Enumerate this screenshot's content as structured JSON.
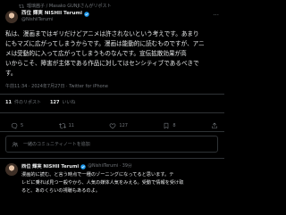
{
  "repost": {
    "text": "瑠璃茜子 / Masako GUNJIさんがリポスト"
  },
  "tweet": {
    "author_name": "西位 輝実 NISHII Terumi",
    "author_handle": "@NishiiTerumi",
    "body": "私は、漫画まではギリだけどアニメは許されないという考えです。あまり\nにもマズに広がってしまうからです。漫画は能動的に読むものですが、アニ\nメは受動的に入って広がってしまうものなんです。宣伝拡散効果が高\nいからこそ、障害が主体である作品に対してはセンシティブであるべきで\nす。",
    "timestamp": "午前11:34 · 2024年7月27日",
    "source": "Twitter for iPhone"
  },
  "stats": {
    "reposts_count": "11",
    "reposts_label": "件のリポスト",
    "likes_count": "127",
    "likes_label": "いいね"
  },
  "actions": {
    "reply_count": "5",
    "retweet_count": "11",
    "like_count": "127",
    "bookmark_count": "8"
  },
  "note_prompt": {
    "text": "一緒のコミュニティノートを追加"
  },
  "reply": {
    "author_name": "西位 輝実 NISHII Terumi",
    "author_handle": "@NishiiTerumi · 39分",
    "body": "漫画的に読む、と言う時点で一種のゾーニングになってると思います。テ\nレビに乗れば見つー般やから、人気の媒体人気をみえる。受動で情報を受け取\nると、あのくらいの視聴もあるのよ。"
  },
  "colors": {
    "background": "#000000",
    "text_primary": "#e7e9ea",
    "text_secondary": "#71767b",
    "divider": "#2f3336",
    "verified": "#1d9bf0"
  }
}
